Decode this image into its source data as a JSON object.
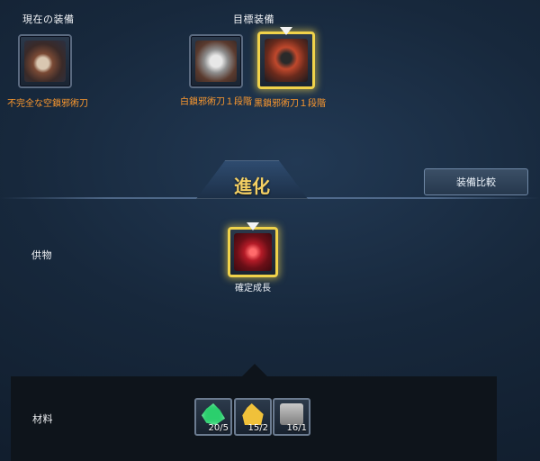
{
  "labels": {
    "current": "現在の装備",
    "target": "目標装備",
    "offering": "供物",
    "materials": "材料"
  },
  "current_item": {
    "name": "不完全な空鎖邪術刀",
    "name_color": "#ff9a2e"
  },
  "targets": [
    {
      "name": "白鎖邪術刀１段階",
      "name_color": "#ff9a2e",
      "selected": false
    },
    {
      "name": "黒鎖邪術刀１段階",
      "name_color": "#ff9a2e",
      "selected": true
    }
  ],
  "evolve": {
    "title": "進化",
    "title_color": "#f5d063"
  },
  "compare_button": {
    "label": "装備比較"
  },
  "offering_item": {
    "name": "確定成長",
    "name_color": "#ffffff",
    "selected": true
  },
  "materials": [
    {
      "icon": "green-crystal-icon",
      "count": "20/5"
    },
    {
      "icon": "gold-crystal-icon",
      "count": "15/2"
    },
    {
      "icon": "chest-icon",
      "count": "16/1"
    }
  ],
  "colors": {
    "accent_gold": "#f0d24a",
    "panel_dark": "#0e141b",
    "background": "#17283c"
  }
}
